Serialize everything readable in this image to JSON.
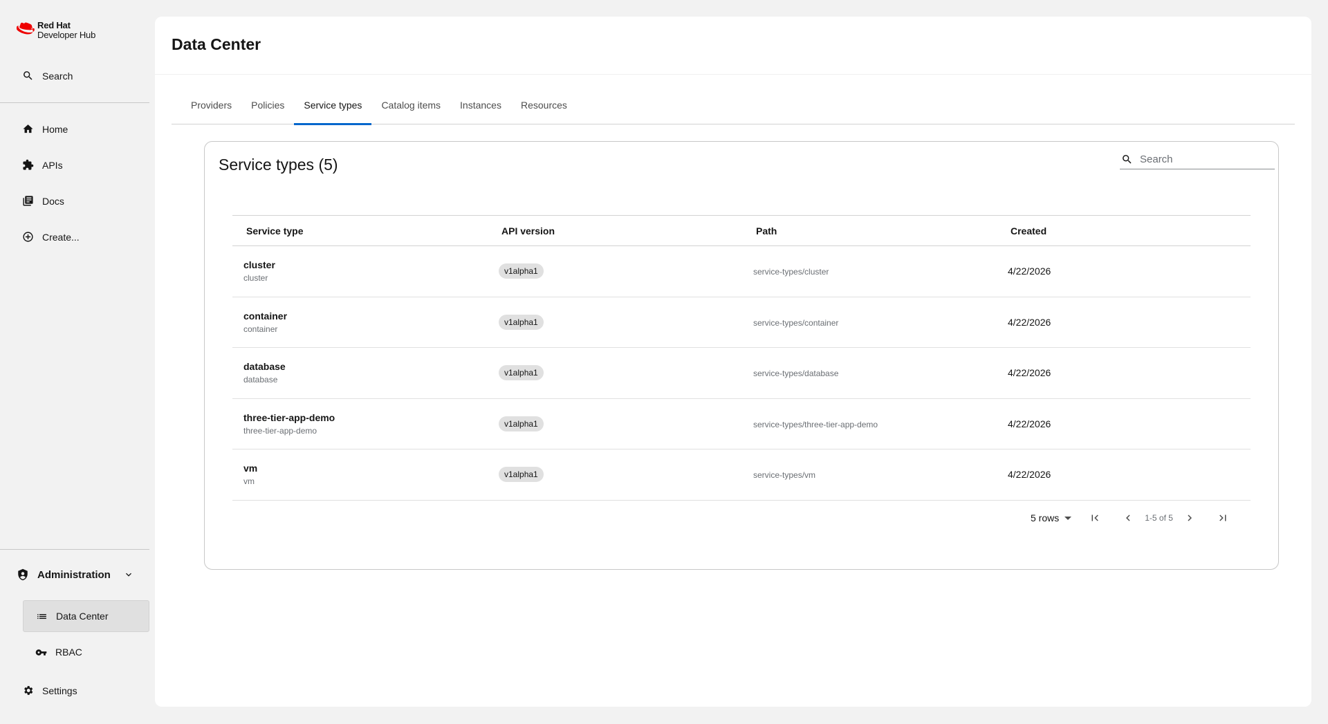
{
  "brand": {
    "line1": "Red Hat",
    "line2": "Developer Hub"
  },
  "sidebar": {
    "search_label": "Search",
    "items": [
      {
        "label": "Home",
        "icon": "home-icon"
      },
      {
        "label": "APIs",
        "icon": "puzzle-icon"
      },
      {
        "label": "Docs",
        "icon": "docs-icon"
      },
      {
        "label": "Create...",
        "icon": "plus-circle-icon"
      }
    ],
    "administration": {
      "label": "Administration",
      "children": [
        {
          "label": "Data Center",
          "icon": "list-icon",
          "active": true
        },
        {
          "label": "RBAC",
          "icon": "key-icon",
          "active": false
        }
      ]
    },
    "settings_label": "Settings"
  },
  "page": {
    "title": "Data Center",
    "tabs": [
      "Providers",
      "Policies",
      "Service types",
      "Catalog items",
      "Instances",
      "Resources"
    ],
    "active_tab": "Service types"
  },
  "card": {
    "title": "Service types (5)",
    "search_placeholder": "Search"
  },
  "table": {
    "columns": [
      "Service type",
      "API version",
      "Path",
      "Created"
    ],
    "rows": [
      {
        "name": "cluster",
        "sub": "cluster",
        "api": "v1alpha1",
        "path": "service-types/cluster",
        "created": "4/22/2026"
      },
      {
        "name": "container",
        "sub": "container",
        "api": "v1alpha1",
        "path": "service-types/container",
        "created": "4/22/2026"
      },
      {
        "name": "database",
        "sub": "database",
        "api": "v1alpha1",
        "path": "service-types/database",
        "created": "4/22/2026"
      },
      {
        "name": "three-tier-app-demo",
        "sub": "three-tier-app-demo",
        "api": "v1alpha1",
        "path": "service-types/three-tier-app-demo",
        "created": "4/22/2026"
      },
      {
        "name": "vm",
        "sub": "vm",
        "api": "v1alpha1",
        "path": "service-types/vm",
        "created": "4/22/2026"
      }
    ]
  },
  "pagination": {
    "rows_label": "5 rows",
    "range": "1-5 of 5"
  },
  "colors": {
    "accent": "#0066cc",
    "brand_red": "#ee0000"
  }
}
